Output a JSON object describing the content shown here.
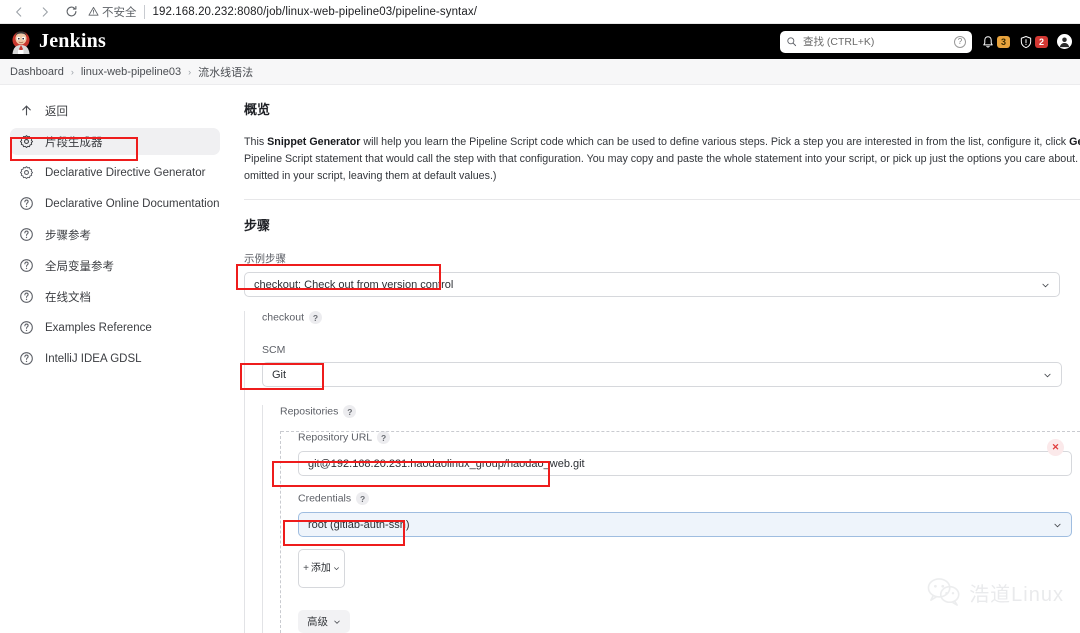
{
  "browser": {
    "back_icon": "arrow-left-icon",
    "forward_icon": "arrow-right-icon",
    "reload_icon": "reload-icon",
    "security_label": "不安全",
    "security_icon": "warning-triangle-icon",
    "url": "192.168.20.232:8080/job/linux-web-pipeline03/pipeline-syntax/"
  },
  "header": {
    "brand": "Jenkins",
    "logo_icon": "jenkins-butler-icon",
    "search": {
      "placeholder": "查找 (CTRL+K)",
      "icon": "search-icon",
      "help_icon": "question-circle-icon",
      "help_label": "?"
    },
    "notifications": {
      "icon": "bell-icon",
      "count": "3",
      "color": "#e8a33d"
    },
    "security": {
      "icon": "shield-icon",
      "count": "2",
      "color": "#d33833"
    },
    "avatar_icon": "user-avatar-icon"
  },
  "breadcrumb": {
    "separator": "›",
    "items": [
      {
        "label": "Dashboard"
      },
      {
        "label": "linux-web-pipeline03"
      },
      {
        "label": "流水线语法"
      }
    ]
  },
  "sidebar": {
    "items": [
      {
        "label": "返回",
        "icon": "arrow-up-icon",
        "active": false
      },
      {
        "label": "片段生成器",
        "icon": "gear-icon",
        "active": true
      },
      {
        "label": "Declarative Directive Generator",
        "icon": "gear-icon",
        "active": false
      },
      {
        "label": "Declarative Online Documentation",
        "icon": "question-circle-icon",
        "active": false
      },
      {
        "label": "步骤参考",
        "icon": "question-circle-icon",
        "active": false
      },
      {
        "label": "全局变量参考",
        "icon": "question-circle-icon",
        "active": false
      },
      {
        "label": "在线文档",
        "icon": "question-circle-icon",
        "active": false
      },
      {
        "label": "Examples Reference",
        "icon": "question-circle-icon",
        "active": false
      },
      {
        "label": "IntelliJ IDEA GDSL",
        "icon": "question-circle-icon",
        "active": false
      }
    ]
  },
  "main": {
    "overview_title": "概览",
    "intro_part1": "This ",
    "intro_bold1": "Snippet Generator",
    "intro_part2": " will help you learn the Pipeline Script code which can be used to define various steps. Pick a step you are interested in from the list, configure it, click ",
    "intro_bold2": "Generate Pipeline Sc",
    "intro_part3": "Pipeline Script statement that would call the step with that configuration. You may copy and paste the whole statement into your script, or pick up just the options you care about. (Most paramete",
    "intro_part4": "omitted in your script, leaving them at default values.)",
    "steps_title": "步骤",
    "sample_step_label": "示例步骤",
    "sample_step_value": "checkout: Check out from version control",
    "checkout_label": "checkout",
    "help_label": "?",
    "scm_label": "SCM",
    "scm_value": "Git",
    "repositories_label": "Repositories",
    "repository_url_label": "Repository URL",
    "repository_url_value": "git@192.168.20.231:haodaolinux_group/haodao_web.git",
    "credentials_label": "Credentials",
    "credentials_value": "root (gitlab-auth-ssh)",
    "add_button_label": "添加",
    "add_button_plus": "+",
    "advanced_button_label": "高级",
    "delete_label": "✕",
    "chevron_icon": "chevron-down-icon"
  },
  "watermark": {
    "text": "浩道Linux",
    "icon": "wechat-icon"
  },
  "colors": {
    "annotation": "#ee1c1c",
    "header_bg": "#000000",
    "active_item_bg": "#f0f0f2"
  }
}
